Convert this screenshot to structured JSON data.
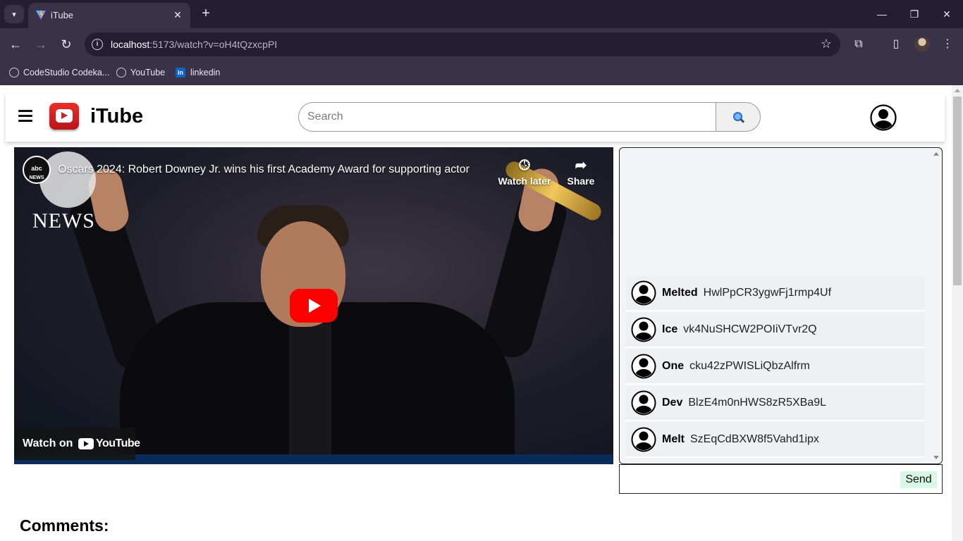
{
  "browser": {
    "tab_title": "iTube",
    "url_host": "localhost",
    "url_rest": ":5173/watch?v=oH4tQzxcpPI",
    "bookmarks": [
      {
        "label": "CodeStudio Codeka...",
        "icon": "globe-icon"
      },
      {
        "label": "YouTube",
        "icon": "globe-icon"
      },
      {
        "label": "linkedin",
        "icon": "linkedin-icon"
      }
    ]
  },
  "header": {
    "brand": "iTube",
    "search_placeholder": "Search",
    "search_button_icon": "magnifier-icon"
  },
  "video": {
    "channel_badge": "abc NEWS",
    "overlay_news_text": "NEWS",
    "title": "Oscars 2024: Robert Downey Jr. wins his first Academy Award for supporting actor",
    "watch_later_label": "Watch later",
    "share_label": "Share",
    "watch_on_label": "Watch on",
    "watch_on_brand": "YouTube"
  },
  "chat": {
    "messages": [
      {
        "name": "Melted",
        "text": "HwlPpCR3ygwFj1rmp4Uf"
      },
      {
        "name": "Ice",
        "text": "vk4NuSHCW2POIiVTvr2Q"
      },
      {
        "name": "One",
        "text": "cku42zPWISLiQbzAlfrm"
      },
      {
        "name": "Dev",
        "text": "BlzE4m0nHWS8zR5XBa9L"
      },
      {
        "name": "Melt",
        "text": "SzEqCdBXW8f5Vahd1ipx"
      }
    ],
    "input_value": "",
    "send_label": "Send"
  },
  "comments": {
    "heading": "Comments:"
  },
  "colors": {
    "chrome_dark": "#241d33",
    "chrome_mid": "#3a3249",
    "brand_red": "#e8302a",
    "send_bg": "#d9f7e6"
  }
}
